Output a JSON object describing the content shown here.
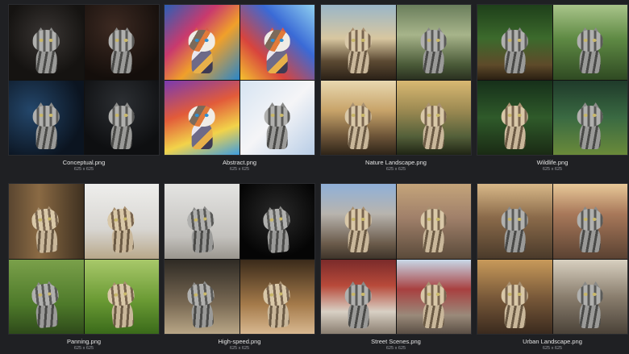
{
  "gallery": {
    "tiles": [
      {
        "filename": "Conceptual.png",
        "dims": "625 x 625"
      },
      {
        "filename": "Abstract.png",
        "dims": "625 x 625"
      },
      {
        "filename": "Nature Landscape.png",
        "dims": "625 x 625"
      },
      {
        "filename": "Wildlife.png",
        "dims": "625 x 625"
      },
      {
        "filename": "Panning.png",
        "dims": "625 x 625"
      },
      {
        "filename": "High-speed.png",
        "dims": "625 x 625"
      },
      {
        "filename": "Street Scenes.png",
        "dims": "625 x 625"
      },
      {
        "filename": "Urban Landscape.png",
        "dims": "625 x 625"
      }
    ]
  },
  "colors": {
    "background": "#1f2023",
    "caption_text": "#e6e6e6",
    "dims_text": "#9a9ca2"
  }
}
